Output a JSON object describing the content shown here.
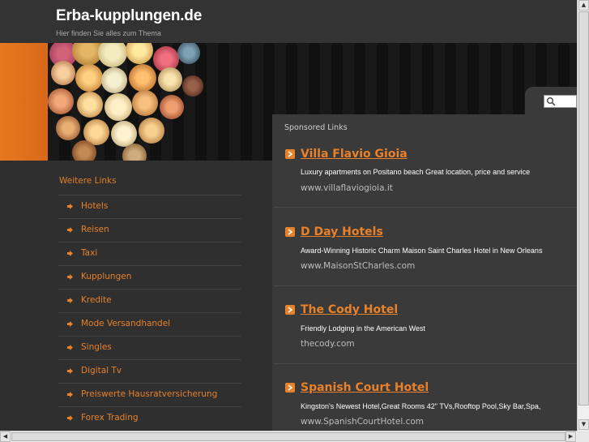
{
  "header": {
    "title": "Erba-kupplungen.de",
    "tagline": "Hier finden Sie alles zum Thema"
  },
  "search": {
    "placeholder": ""
  },
  "sidebar": {
    "heading": "Weitere Links",
    "items": [
      {
        "label": "Hotels"
      },
      {
        "label": "Reisen"
      },
      {
        "label": "Taxi"
      },
      {
        "label": "Kupplungen"
      },
      {
        "label": "Kredite"
      },
      {
        "label": "Mode Versandhandel"
      },
      {
        "label": "Singles"
      },
      {
        "label": "Digital Tv"
      },
      {
        "label": "Preiswerte Hausratversicherung"
      },
      {
        "label": "Forex Trading"
      }
    ]
  },
  "main": {
    "sponsored_label": "Sponsored Links",
    "ads": [
      {
        "title": "Villa Flavio Gioia",
        "description": "Luxury apartments on Positano beach Great location, price and service",
        "url": "www.villaflaviogioia.it"
      },
      {
        "title": "D Day Hotels",
        "description": "Award-Winning Historic Charm Maison Saint Charles Hotel in New Orleans",
        "url": "www.MaisonStCharles.com"
      },
      {
        "title": "The Cody Hotel",
        "description": "Friendly Lodging in the American West",
        "url": "thecody.com"
      },
      {
        "title": "Spanish Court Hotel",
        "description": "Kingston's Newest Hotel,Great Rooms 42\" TVs,Rooftop Pool,Sky Bar,Spa,",
        "url": "www.SpanishCourtHotel.com"
      }
    ]
  },
  "colors": {
    "accent": "#e8812a",
    "background": "#2f2f2f",
    "header_bg": "#333333",
    "content_bg": "#3a3a3a"
  },
  "icons": {
    "search": "search-icon",
    "nav_bullet": "arrow-right-icon",
    "ad_bullet": "arrow-box-icon"
  }
}
